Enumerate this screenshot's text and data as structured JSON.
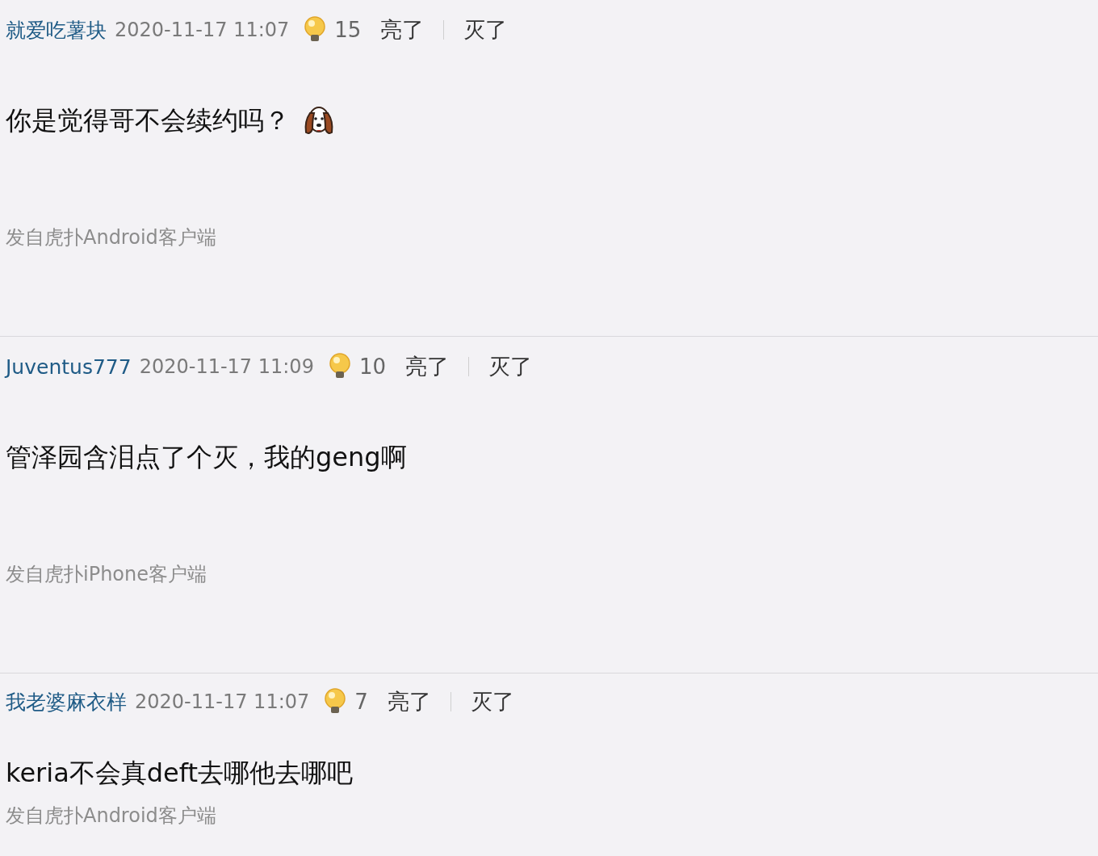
{
  "comments": [
    {
      "user": "就爱吃薯块",
      "time": "2020-11-17 11:07",
      "likes": "15",
      "light": "亮了",
      "dark": "灭了",
      "text": "你是觉得哥不会续约吗？",
      "emoji": true,
      "source": "发自虎扑Android客户端"
    },
    {
      "user": "Juventus777",
      "time": "2020-11-17 11:09",
      "likes": "10",
      "light": "亮了",
      "dark": "灭了",
      "text": "管泽园含泪点了个灭，我的geng啊",
      "emoji": false,
      "source": "发自虎扑iPhone客户端"
    },
    {
      "user": "我老婆麻衣样",
      "time": "2020-11-17 11:07",
      "likes": "7",
      "light": "亮了",
      "dark": "灭了",
      "text": "keria不会真deft去哪他去哪吧",
      "emoji": false,
      "source": "发自虎扑Android客户端"
    }
  ]
}
